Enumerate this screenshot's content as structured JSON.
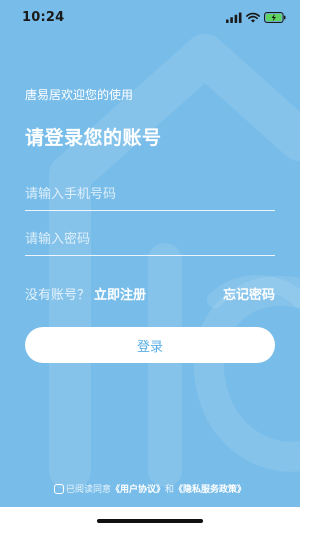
{
  "status_bar": {
    "time": "10:24",
    "icons": [
      "signal-icon",
      "wifi-icon",
      "battery-charging-icon"
    ]
  },
  "greeting": "唐易居欢迎您的使用",
  "title": "请登录您的账号",
  "phone_field": {
    "placeholder": "请输入手机号码",
    "value": ""
  },
  "password_field": {
    "placeholder": "请输入密码",
    "value": ""
  },
  "register": {
    "prompt": "没有账号？",
    "link": "立即注册"
  },
  "forgot_password": "忘记密码",
  "login_button": "登录",
  "agreement": {
    "prefix": "已阅读同意",
    "user_agreement": "《用户协议》",
    "conjunction": "和",
    "privacy_policy": "《隐私服务政策》",
    "checked": false
  },
  "colors": {
    "background": "#78bde9",
    "button_text": "#5aaee6",
    "battery": "#5fd35f"
  }
}
